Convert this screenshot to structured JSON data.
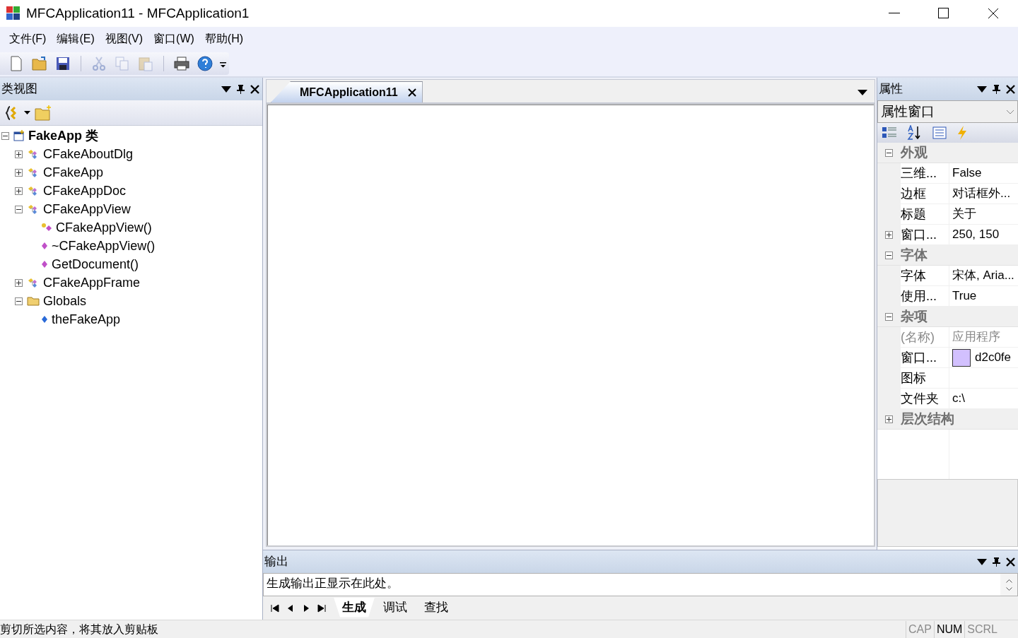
{
  "window": {
    "title": "MFCApplication11 - MFCApplication1"
  },
  "menu": [
    "文件(F)",
    "编辑(E)",
    "视图(V)",
    "窗口(W)",
    "帮助(H)"
  ],
  "toolbar": [
    {
      "kind": "new",
      "disabled": false
    },
    {
      "kind": "open",
      "disabled": false
    },
    {
      "kind": "save",
      "disabled": false
    },
    {
      "kind": "sep"
    },
    {
      "kind": "cut",
      "disabled": true
    },
    {
      "kind": "copy",
      "disabled": true
    },
    {
      "kind": "paste",
      "disabled": true
    },
    {
      "kind": "sep"
    },
    {
      "kind": "print",
      "disabled": false
    },
    {
      "kind": "help",
      "disabled": false
    }
  ],
  "class_view": {
    "title": "类视图",
    "tree": [
      {
        "label": "FakeApp 类",
        "kind": "root",
        "expanded": true,
        "children": [
          {
            "label": "CFakeAboutDlg",
            "kind": "class",
            "expanded": false
          },
          {
            "label": "CFakeApp",
            "kind": "class",
            "expanded": false
          },
          {
            "label": "CFakeAppDoc",
            "kind": "class",
            "expanded": false
          },
          {
            "label": "CFakeAppView",
            "kind": "class",
            "expanded": true,
            "children": [
              {
                "label": "CFakeAppView()",
                "kind": "protected-method"
              },
              {
                "label": "~CFakeAppView()",
                "kind": "method"
              },
              {
                "label": "GetDocument()",
                "kind": "method"
              }
            ]
          },
          {
            "label": "CFakeAppFrame",
            "kind": "class",
            "expanded": false
          },
          {
            "label": "Globals",
            "kind": "folder",
            "expanded": true,
            "children": [
              {
                "label": "theFakeApp",
                "kind": "variable"
              }
            ]
          }
        ]
      }
    ]
  },
  "document_tabs": [
    {
      "label": "MFCApplication11",
      "selected": true
    }
  ],
  "properties": {
    "title": "属性",
    "object": "属性窗口",
    "categories": [
      {
        "name": "外观",
        "expanded": true,
        "rows": [
          {
            "name": "三维...",
            "value": "False",
            "disabled": false
          },
          {
            "name": "边框",
            "value": "对话框外...",
            "disabled": false
          },
          {
            "name": "标题",
            "value": "关于",
            "disabled": false
          },
          {
            "name": "窗口...",
            "value": "250, 150",
            "disabled": false,
            "expandable": true
          }
        ]
      },
      {
        "name": "字体",
        "expanded": true,
        "rows": [
          {
            "name": "字体",
            "value": "宋体, Aria...",
            "disabled": false
          },
          {
            "name": "使用...",
            "value": "True",
            "disabled": false
          }
        ]
      },
      {
        "name": "杂项",
        "expanded": true,
        "rows": [
          {
            "name": "(名称)",
            "value": "应用程序",
            "disabled": true
          },
          {
            "name": "窗口...",
            "value": "d2c0fe",
            "disabled": false,
            "color": "#d2c0fe"
          },
          {
            "name": "图标",
            "disabled": false
          },
          {
            "name": "文件夹",
            "value": "c:\\",
            "disabled": false
          }
        ]
      },
      {
        "name": "层次结构",
        "expanded": false
      }
    ]
  },
  "output": {
    "title": "输出",
    "lines": [
      "生成输出正显示在此处。"
    ],
    "tabs": [
      {
        "label": "生成",
        "selected": true
      },
      {
        "label": "调试",
        "selected": false
      },
      {
        "label": "查找",
        "selected": false
      }
    ]
  },
  "status_bar": {
    "message": "剪切所选内容，将其放入剪贴板",
    "indicators": [
      {
        "label": "CAP",
        "on": false
      },
      {
        "label": "NUM",
        "on": true
      },
      {
        "label": "SCRL",
        "on": false
      }
    ]
  }
}
